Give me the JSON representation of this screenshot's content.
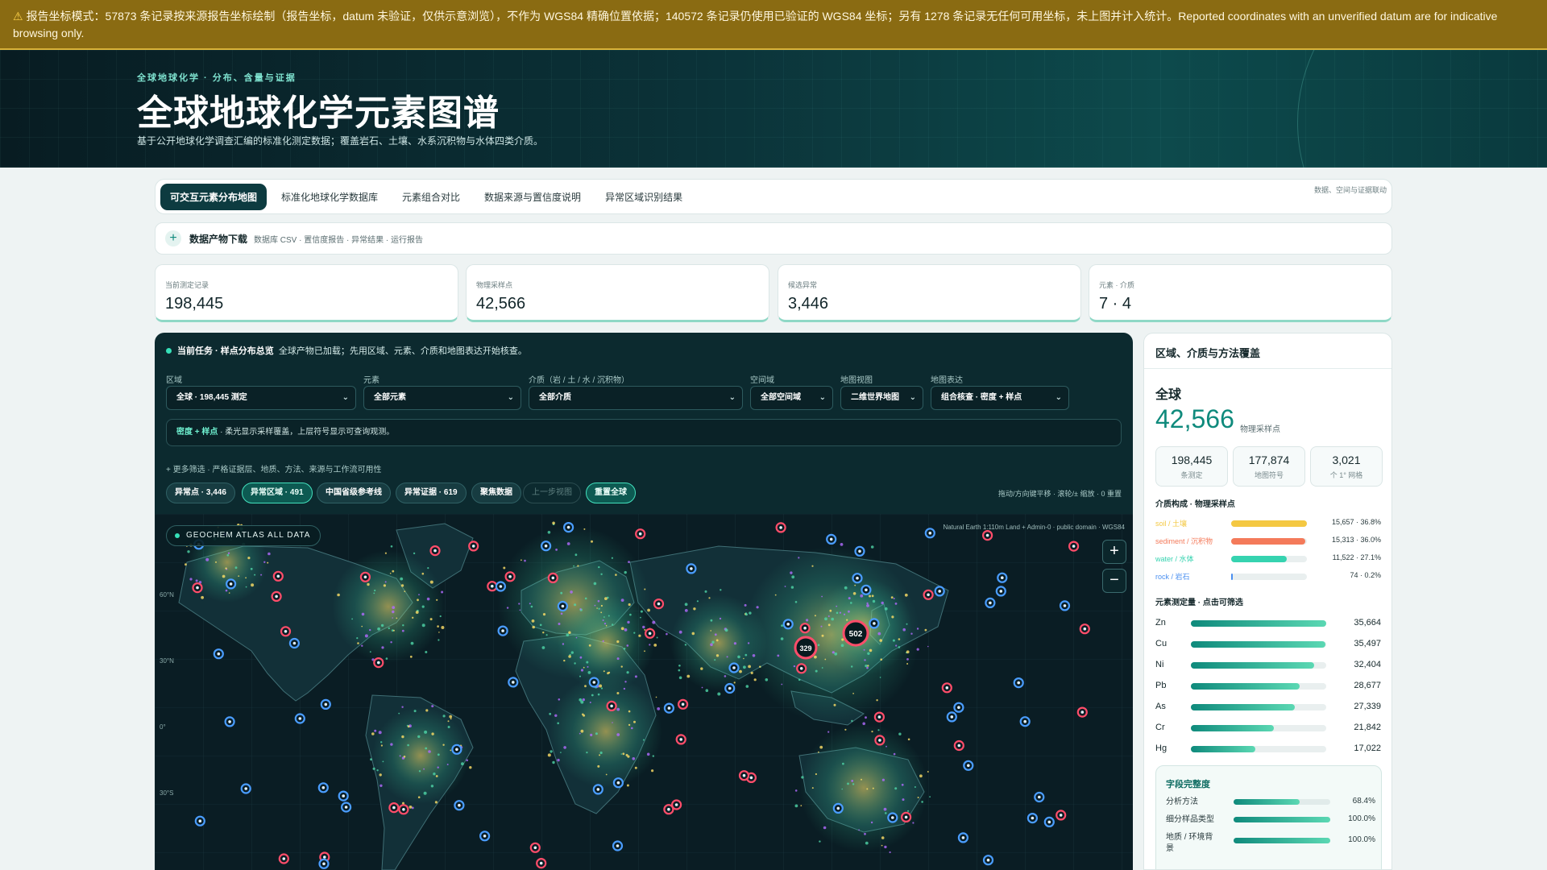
{
  "banner": {
    "text": "报告坐标模式：57873 条记录按来源报告坐标绘制（报告坐标，datum 未验证，仅供示意浏览），不作为 WGS84 精确位置依据；140572 条记录仍使用已验证的 WGS84 坐标；另有 1278 条记录无任何可用坐标，未上图并计入统计。Reported coordinates with an unverified datum are for indicative browsing only.",
    "icon": "warning-icon"
  },
  "hero": {
    "eyebrow": "全球地球化学 · 分布、含量与证据",
    "title": "全球地球化学元素图谱",
    "subtitle": "基于公开地球化学调查汇编的标准化测定数据；覆盖岩石、土壤、水系沉积物与水体四类介质。"
  },
  "tabs": {
    "items": [
      "可交互元素分布地图",
      "标准化地球化学数据库",
      "元素组合对比",
      "数据来源与置信度说明",
      "异常区域识别结果"
    ],
    "hint": "数据、空间与证据联动"
  },
  "downloads": {
    "title": "数据产物下载",
    "items": "数据库 CSV · 置信度报告 · 异常结果 · 运行报告"
  },
  "stats": [
    {
      "label": "当前测定记录",
      "value": "198,445"
    },
    {
      "label": "物理采样点",
      "value": "42,566"
    },
    {
      "label": "候选异常",
      "value": "3,446"
    },
    {
      "label": "元素 · 介质",
      "value": "7 · 4"
    }
  ],
  "task": {
    "title": "当前任务 · 样点分布总览",
    "text": "全球产物已加载；先用区域、元素、介质和地图表达开始核查。"
  },
  "filters": {
    "region": {
      "label": "区域",
      "value": "全球 · 198,445 测定"
    },
    "element": {
      "label": "元素",
      "value": "全部元素"
    },
    "medium": {
      "label": "介质（岩 / 土 / 水 / 沉积物）",
      "value": "全部介质"
    },
    "spatial": {
      "label": "空间域",
      "value": "全部空间域"
    },
    "view": {
      "label": "地图视图",
      "value": "二维世界地图"
    },
    "display": {
      "label": "地图表达",
      "value": "组合核查 · 密度 + 样点"
    }
  },
  "note": {
    "strong": "密度 + 样点",
    "text": " · 柔光显示采样覆盖，上层符号显示可查询观测。"
  },
  "more_filters": "+ 更多筛选 · 严格证据层、地质、方法、来源与工作流可用性",
  "chips": [
    "异常点 · 3,446",
    "异常区域 · 491",
    "中国省级参考线",
    "异常证据 · 619",
    "聚焦数据",
    "上一步视图",
    "重置全球"
  ],
  "map_hint": "拖动/方向键平移 · 滚轮/± 缩放 · 0 重置",
  "map": {
    "badge": "GEOCHEM ATLAS  ALL DATA",
    "attribution": "Natural Earth 1:110m Land + Admin-0 · public domain · WGS84",
    "zoom_in": "+",
    "zoom_out": "−",
    "lat_labels": [
      "60°N",
      "30°N",
      "0°",
      "30°S"
    ],
    "cluster_labels": [
      "502",
      "329"
    ],
    "colors": {
      "ocean": "#0a1d24",
      "land": "#123038",
      "anomaly": "#ff4d6a",
      "sample": "#4a9dff",
      "density": "#ffe066"
    }
  },
  "side": {
    "title": "区域、介质与方法覆盖",
    "region": "全球",
    "points": "42,566",
    "points_unit": "物理采样点",
    "minis": [
      {
        "value": "198,445",
        "label": "条测定"
      },
      {
        "value": "177,874",
        "label": "地图符号"
      },
      {
        "value": "3,021",
        "label": "个 1° 网格"
      }
    ],
    "media_title": "介质构成 · 物理采样点",
    "media": [
      {
        "name": "soil / 土壤",
        "value": "15,657 · 36.8%",
        "pct": 36.8,
        "color": "#f4c842"
      },
      {
        "name": "sediment / 沉积物",
        "value": "15,313 · 36.0%",
        "pct": 36.0,
        "color": "#f47a5a"
      },
      {
        "name": "water / 水体",
        "value": "11,522 · 27.1%",
        "pct": 27.1,
        "color": "#36d3b0"
      },
      {
        "name": "rock / 岩石",
        "value": "74 · 0.2%",
        "pct": 0.2,
        "color": "#4a8ff0"
      }
    ],
    "elements_title": "元素测定量 · 点击可筛选",
    "elements": [
      {
        "name": "Zn",
        "value": "35,664",
        "count": 35664
      },
      {
        "name": "Cu",
        "value": "35,497",
        "count": 35497
      },
      {
        "name": "Ni",
        "value": "32,404",
        "count": 32404
      },
      {
        "name": "Pb",
        "value": "28,677",
        "count": 28677
      },
      {
        "name": "As",
        "value": "27,339",
        "count": 27339
      },
      {
        "name": "Cr",
        "value": "21,842",
        "count": 21842
      },
      {
        "name": "Hg",
        "value": "17,022",
        "count": 17022
      }
    ],
    "completeness_title": "字段完整度",
    "completeness": [
      {
        "name": "分析方法",
        "value": "68.4%",
        "pct": 68.4
      },
      {
        "name": "细分样品类型",
        "value": "100.0%",
        "pct": 100
      },
      {
        "name": "地质 / 环境背景",
        "value": "100.0%",
        "pct": 100
      }
    ]
  }
}
